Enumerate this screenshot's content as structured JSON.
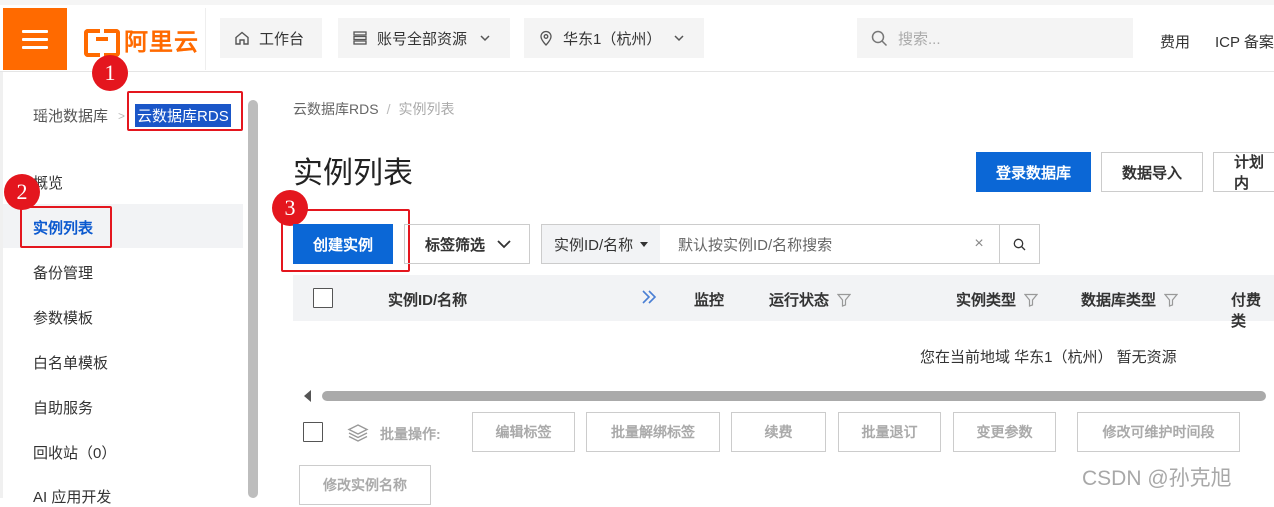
{
  "header": {
    "logo_text": "阿里云",
    "workbench": "工作台",
    "resources": "账号全部资源",
    "region": "华东1（杭州）",
    "search_placeholder": "搜索...",
    "links": [
      "费用",
      "ICP 备案"
    ]
  },
  "sidebar": {
    "breadcrumb": [
      "瑶池数据库",
      "云数据库RDS"
    ],
    "breadcrumb_sep": ">",
    "items": [
      {
        "label": "概览"
      },
      {
        "label": "实例列表",
        "active": true
      },
      {
        "label": "备份管理"
      },
      {
        "label": "参数模板"
      },
      {
        "label": "白名单模板"
      },
      {
        "label": "自助服务"
      },
      {
        "label": "回收站（0）"
      },
      {
        "label": "AI 应用开发"
      }
    ]
  },
  "annotations": [
    "1",
    "2",
    "3"
  ],
  "main": {
    "breadcrumb": [
      "云数据库RDS",
      "实例列表"
    ],
    "breadcrumb_sep": "/",
    "title": "实例列表",
    "top_buttons": [
      "登录数据库",
      "数据导入",
      "计划内"
    ],
    "create_button": "创建实例",
    "tag_filter": "标签筛选",
    "search_field": "实例ID/名称",
    "search_placeholder": "默认按实例ID/名称搜索",
    "clear_symbol": "×",
    "columns": [
      "实例ID/名称",
      "监控",
      "运行状态",
      "实例类型",
      "数据库类型",
      "付费类"
    ],
    "empty_text": "您在当前地域 华东1（杭州） 暂无资源",
    "batch_label": "批量操作:",
    "batch_buttons": [
      "编辑标签",
      "批量解绑标签",
      "续费",
      "批量退订",
      "变更参数",
      "修改可维护时间段",
      "修改实例名称"
    ]
  },
  "watermark": "CSDN @孙克旭",
  "colors": {
    "brand": "#ff6a00",
    "primary": "#0b67d6",
    "annotation": "#e4161e"
  }
}
